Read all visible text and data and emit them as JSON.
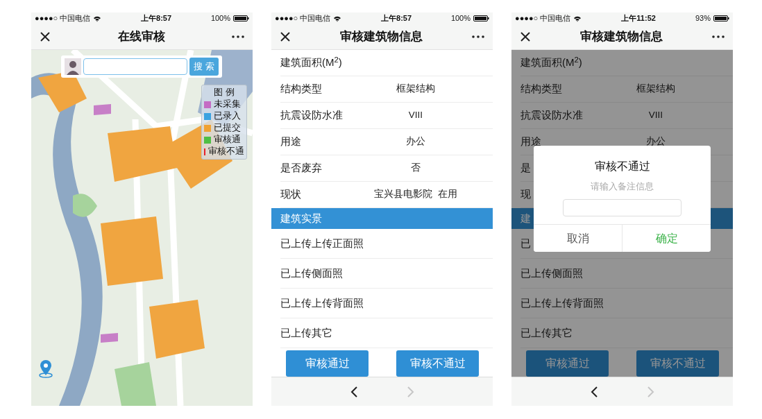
{
  "phones": [
    {
      "kind": "map",
      "status_bar": {
        "carrier": "●●●●○ 中国电信",
        "time": "上午8:57",
        "battery": "100%"
      },
      "nav": {
        "title": "在线审核"
      },
      "search": {
        "button": "搜 索"
      },
      "legend": {
        "title": "图 例",
        "items": [
          {
            "label": "未采集",
            "color": "#c46cc4"
          },
          {
            "label": "已录入",
            "color": "#3aa2e0"
          },
          {
            "label": "已提交",
            "color": "#f0a233"
          },
          {
            "label": "审核通",
            "color": "#4fbf45"
          },
          {
            "label": "审核不通",
            "color": "#e8202a"
          }
        ]
      }
    },
    {
      "kind": "form",
      "status_bar": {
        "carrier": "●●●●○ 中国电信",
        "time": "上午8:57",
        "battery": "100%"
      },
      "nav": {
        "title": "审核建筑物信息"
      },
      "fields": [
        {
          "label": "建筑面积(M$^{2}$)"
        },
        {
          "label": "结构类型",
          "value": "框架结构"
        },
        {
          "label": "抗震设防水准",
          "value": "VIII"
        },
        {
          "label": "用途",
          "value": "办公"
        },
        {
          "label": "是否废弃",
          "value": "否"
        },
        {
          "label": "现状",
          "value": "宝兴县电影院  在用"
        }
      ],
      "section": "建筑实景",
      "photos": [
        "已上传上传正面照",
        "已上传侧面照",
        "已上传上传背面照",
        "已上传其它"
      ],
      "buttons": [
        "审核通过",
        "审核不通过"
      ],
      "toolbar": [
        {
          "kind": "back",
          "disabled": false
        },
        {
          "kind": "forward",
          "disabled": true
        }
      ]
    },
    {
      "kind": "form",
      "dimmed": true,
      "status_bar": {
        "carrier": "●●●●○ 中国电信",
        "time": "上午11:52",
        "battery": "93%"
      },
      "nav": {
        "title": "审核建筑物信息"
      },
      "fields": [
        {
          "label": "建筑面积(M$^{2}$)"
        },
        {
          "label": "结构类型",
          "value": "框架结构"
        },
        {
          "label": "抗震设防水准",
          "value": "VIII"
        },
        {
          "label": "用途",
          "value": "办公"
        },
        {
          "label": "是"
        },
        {
          "label": "现"
        }
      ],
      "section": "建",
      "photos": [
        "已",
        "已上传侧面照",
        "已上传上传背面照",
        "已上传其它"
      ],
      "buttons": [
        "审核通过",
        "审核不通过"
      ],
      "toolbar": [
        {
          "kind": "back",
          "disabled": false
        },
        {
          "kind": "forward",
          "disabled": true
        }
      ],
      "dialog": {
        "title": "审核不通过",
        "message": "请输入备注信息",
        "cancel": "取消",
        "confirm": "确定"
      }
    }
  ]
}
